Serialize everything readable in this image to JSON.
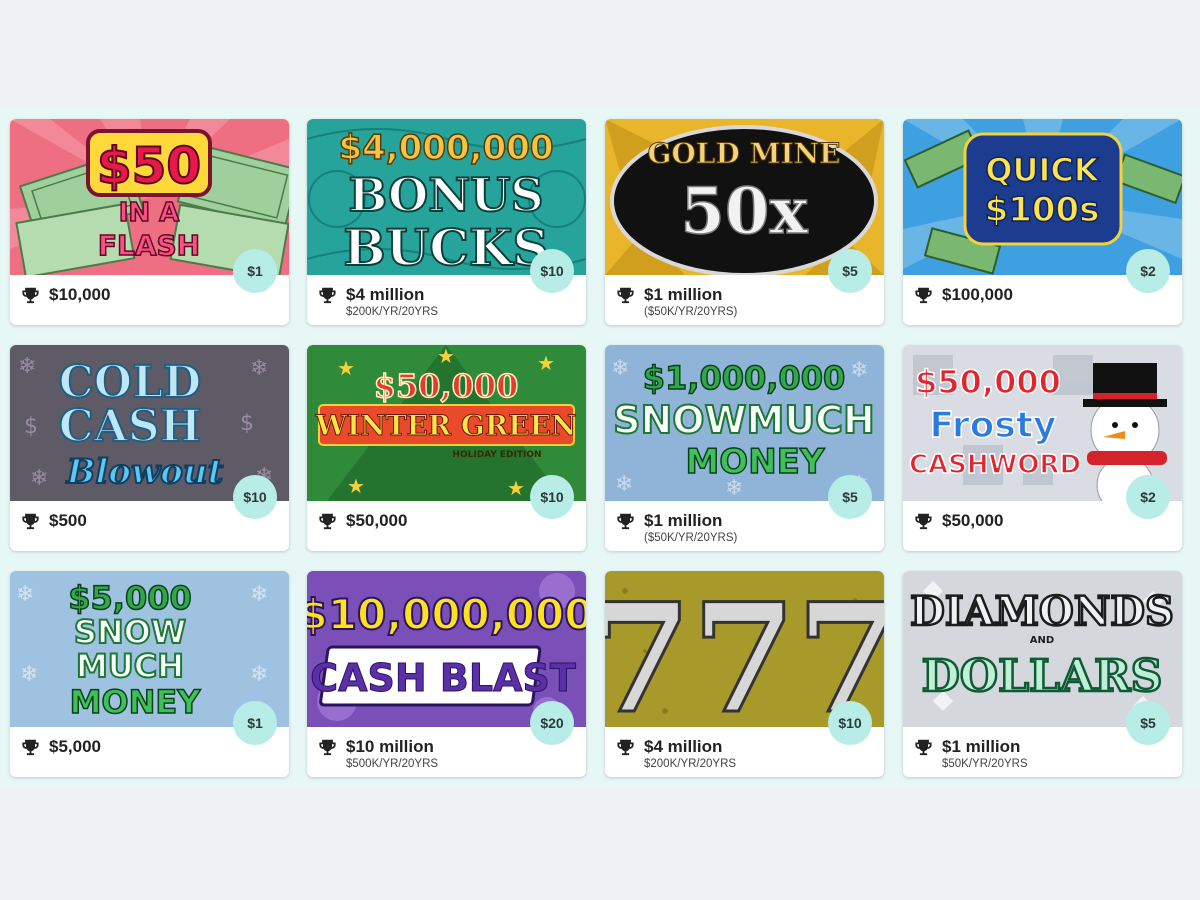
{
  "colors": {
    "band": "#e6f7f5",
    "price_badge": "#b8ece6",
    "page_bg": "#f0f1f2"
  },
  "games": [
    {
      "name": "$50 IN A FLASH",
      "art": {
        "lines": [
          "$50",
          "IN A",
          "FLASH"
        ]
      },
      "price": "$1",
      "prize": "$10,000",
      "terms": ""
    },
    {
      "name": "$4,000,000 BONUS BUCKS",
      "art": {
        "lines": [
          "$4,000,000",
          "BONUS",
          "BUCKS"
        ]
      },
      "price": "$10",
      "prize": "$4 million",
      "terms": "$200K/YR/20YRS"
    },
    {
      "name": "GOLD MINE 50x",
      "art": {
        "lines": [
          "GOLD MINE",
          "50x"
        ]
      },
      "price": "$5",
      "prize": "$1 million",
      "terms": "($50K/YR/20YRS)"
    },
    {
      "name": "QUICK $100s",
      "art": {
        "lines": [
          "QUICK",
          "$100s"
        ]
      },
      "price": "$2",
      "prize": "$100,000",
      "terms": ""
    },
    {
      "name": "COLD CASH Blowout",
      "art": {
        "lines": [
          "COLD",
          "CASH",
          "Blowout"
        ]
      },
      "price": "$10",
      "prize": "$500",
      "terms": ""
    },
    {
      "name": "$50,000 WINTER GREEN",
      "art": {
        "lines": [
          "$50,000",
          "WINTER GREEN",
          "HOLIDAY EDITION"
        ]
      },
      "price": "$10",
      "prize": "$50,000",
      "terms": ""
    },
    {
      "name": "$1,000,000 SNOWMUCH MONEY",
      "art": {
        "lines": [
          "$1,000,000",
          "SNOWMUCH",
          "MONEY"
        ]
      },
      "price": "$5",
      "prize": "$1 million",
      "terms": "($50K/YR/20YRS)"
    },
    {
      "name": "$50,000 Frosty CASHWORD",
      "art": {
        "lines": [
          "$50,000",
          "Frosty",
          "CASHWORD"
        ]
      },
      "price": "$2",
      "prize": "$50,000",
      "terms": ""
    },
    {
      "name": "$5,000 SNOW MUCH MONEY",
      "art": {
        "lines": [
          "$5,000",
          "SNOW",
          "MUCH",
          "MONEY"
        ]
      },
      "price": "$1",
      "prize": "$5,000",
      "terms": ""
    },
    {
      "name": "$10,000,000 CASH BLAST",
      "art": {
        "lines": [
          "$10,000,000",
          "CASH BLAST"
        ]
      },
      "price": "$20",
      "prize": "$10 million",
      "terms": "$500K/YR/20YRS"
    },
    {
      "name": "777",
      "art": {
        "lines": [
          "777"
        ]
      },
      "price": "$10",
      "prize": "$4 million",
      "terms": "$200K/YR/20YRS"
    },
    {
      "name": "DIAMONDS AND DOLLARS",
      "art": {
        "lines": [
          "DIAMONDS",
          "AND",
          "DOLLARS"
        ]
      },
      "price": "$5",
      "prize": "$1 million",
      "terms": "$50K/YR/20YRS"
    }
  ]
}
